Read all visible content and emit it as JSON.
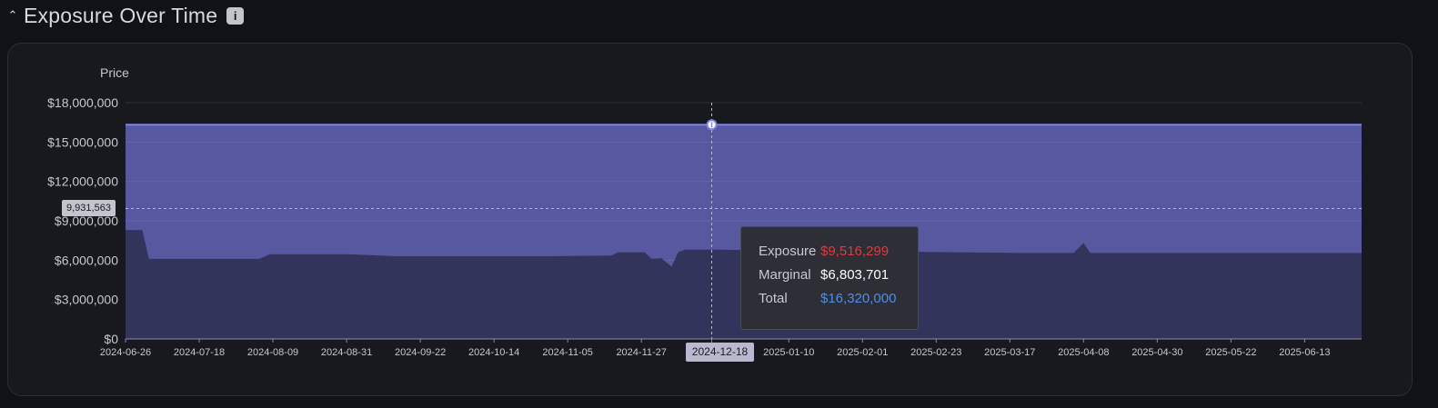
{
  "header": {
    "collapse_icon": "chevron-up-icon",
    "title": "Exposure Over Time",
    "info_label": "i"
  },
  "chart_data": {
    "type": "area",
    "title": "",
    "ylabel": "Price",
    "xlabel": "",
    "ylim": [
      0,
      18000000
    ],
    "yticks": [
      "$18,000,000",
      "$15,000,000",
      "$12,000,000",
      "$9,000,000",
      "$6,000,000",
      "$3,000,000",
      "$0"
    ],
    "xticks": [
      "2024-06-26",
      "2024-07-18",
      "2024-08-09",
      "2024-08-31",
      "2024-09-22",
      "2024-10-14",
      "2024-11-05",
      "2024-11-27",
      "2024-12-18",
      "2025-01-10",
      "2025-02-01",
      "2025-02-23",
      "2025-03-17",
      "2025-04-08",
      "2025-04-30",
      "2025-05-22",
      "2025-06-13"
    ],
    "grid": true,
    "colors": {
      "total_line": "#7f82e8",
      "total_fill": "#5758a0",
      "marginal_fill": "#33345b",
      "exposure": "#e0393e",
      "total_text": "#4f8fe6"
    },
    "series": [
      {
        "name": "Total",
        "points": [
          [
            "2024-06-26",
            16320000
          ],
          [
            "2025-06-30",
            16320000
          ]
        ]
      },
      {
        "name": "Marginal",
        "points": [
          [
            "2024-06-26",
            8300000
          ],
          [
            "2024-07-01",
            8300000
          ],
          [
            "2024-07-03",
            6100000
          ],
          [
            "2024-08-05",
            6100000
          ],
          [
            "2024-08-08",
            6450000
          ],
          [
            "2024-09-01",
            6450000
          ],
          [
            "2024-09-15",
            6300000
          ],
          [
            "2024-10-31",
            6300000
          ],
          [
            "2024-11-18",
            6350000
          ],
          [
            "2024-11-20",
            6600000
          ],
          [
            "2024-11-28",
            6600000
          ],
          [
            "2024-11-30",
            6100000
          ],
          [
            "2024-12-03",
            6150000
          ],
          [
            "2024-12-06",
            5500000
          ],
          [
            "2024-12-08",
            6600000
          ],
          [
            "2024-12-10",
            6800000
          ],
          [
            "2024-12-18",
            6803701
          ],
          [
            "2025-03-20",
            6550000
          ],
          [
            "2025-04-05",
            6550000
          ],
          [
            "2025-04-08",
            7300000
          ],
          [
            "2025-04-10",
            6550000
          ],
          [
            "2025-06-30",
            6550000
          ]
        ]
      }
    ],
    "hover": {
      "date": "2024-12-18",
      "y_value_label": "9,931,563",
      "y_value": 9931563,
      "tooltip": {
        "exposure_label": "Exposure",
        "exposure_value": "$9,516,299",
        "marginal_label": "Marginal",
        "marginal_value": "$6,803,701",
        "total_label": "Total",
        "total_value": "$16,320,000"
      }
    }
  }
}
